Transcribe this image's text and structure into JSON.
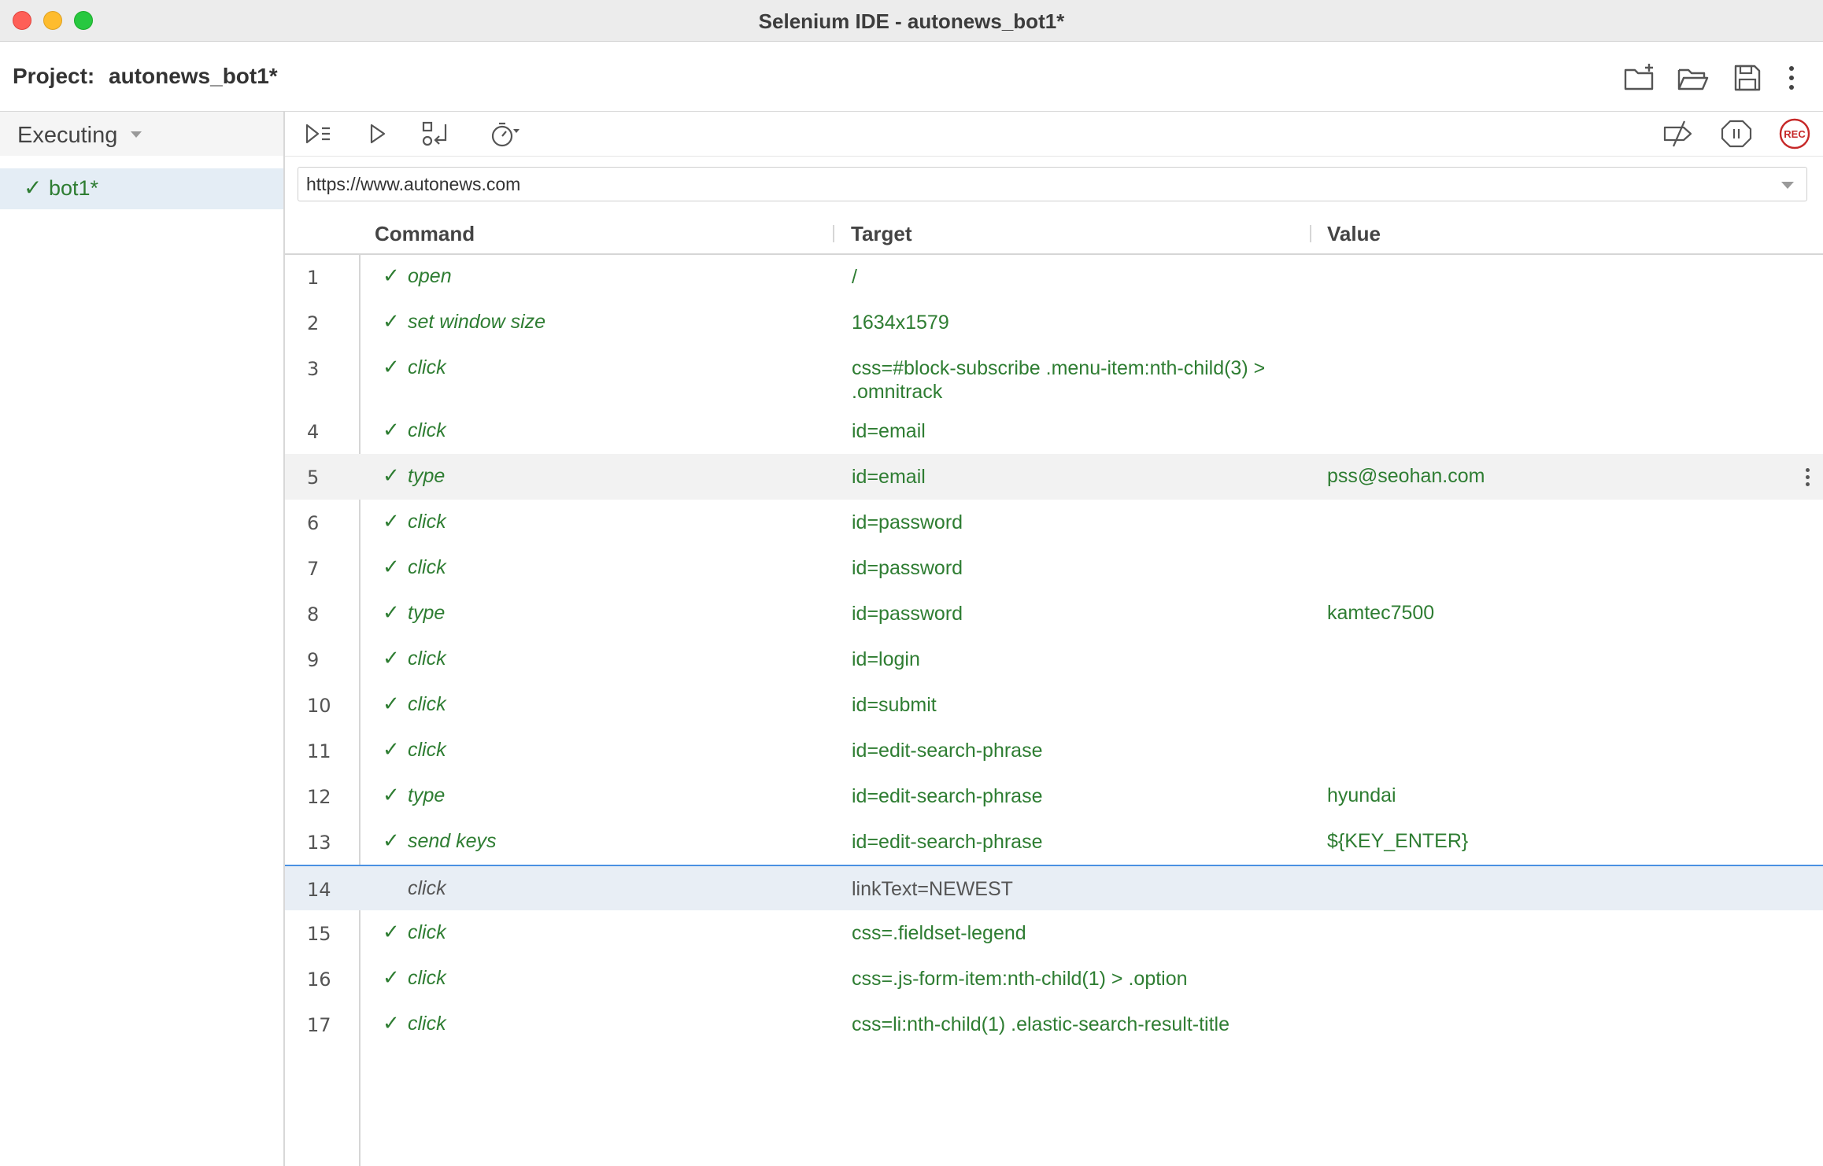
{
  "window": {
    "title": "Selenium IDE - autonews_bot1*"
  },
  "project": {
    "label": "Project:",
    "name": "autonews_bot1*"
  },
  "sidebar": {
    "mode_label": "Executing",
    "tests": [
      {
        "name": "bot1*",
        "status": "passed"
      }
    ]
  },
  "url_bar": {
    "value": "https://www.autonews.com"
  },
  "table": {
    "headers": {
      "command": "Command",
      "target": "Target",
      "value": "Value"
    },
    "rows": [
      {
        "num": "1",
        "command": "open",
        "target": "/",
        "value": "",
        "status": "passed"
      },
      {
        "num": "2",
        "command": "set window size",
        "target": "1634x1579",
        "value": "",
        "status": "passed"
      },
      {
        "num": "3",
        "command": "click",
        "target": "css=#block-subscribe .menu-item:nth-child(3) > .omnitrack",
        "value": "",
        "status": "passed"
      },
      {
        "num": "4",
        "command": "click",
        "target": "id=email",
        "value": "",
        "status": "passed"
      },
      {
        "num": "5",
        "command": "type",
        "target": "id=email",
        "value": "pss@seohan.com",
        "status": "passed"
      },
      {
        "num": "6",
        "command": "click",
        "target": "id=password",
        "value": "",
        "status": "passed"
      },
      {
        "num": "7",
        "command": "click",
        "target": "id=password",
        "value": "",
        "status": "passed"
      },
      {
        "num": "8",
        "command": "type",
        "target": "id=password",
        "value": "kamtec7500",
        "status": "passed"
      },
      {
        "num": "9",
        "command": "click",
        "target": "id=login",
        "value": "",
        "status": "passed"
      },
      {
        "num": "10",
        "command": "click",
        "target": "id=submit",
        "value": "",
        "status": "passed"
      },
      {
        "num": "11",
        "command": "click",
        "target": "id=edit-search-phrase",
        "value": "",
        "status": "passed"
      },
      {
        "num": "12",
        "command": "type",
        "target": "id=edit-search-phrase",
        "value": "hyundai",
        "status": "passed"
      },
      {
        "num": "13",
        "command": "send keys",
        "target": "id=edit-search-phrase",
        "value": "${KEY_ENTER}",
        "status": "passed"
      },
      {
        "num": "14",
        "command": "click",
        "target": "linkText=NEWEST",
        "value": "",
        "status": "pending"
      },
      {
        "num": "15",
        "command": "click",
        "target": "css=.fieldset-legend",
        "value": "",
        "status": "passed"
      },
      {
        "num": "16",
        "command": "click",
        "target": "css=.js-form-item:nth-child(1) > .option",
        "value": "",
        "status": "passed"
      },
      {
        "num": "17",
        "command": "click",
        "target": "css=li:nth-child(1) .elastic-search-result-title",
        "value": "",
        "status": "passed"
      }
    ]
  },
  "toolbar": {
    "icons": [
      "run-all-icon",
      "run-icon",
      "step-over-icon",
      "speed-icon",
      "disable-breakpoints-icon",
      "pause-exceptions-icon",
      "record-icon"
    ],
    "record_label": "REC"
  },
  "header_icons": [
    "new-project-icon",
    "open-project-icon",
    "save-project-icon",
    "more-icon"
  ],
  "colors": {
    "passed": "#2e7d32",
    "current_row_bg": "#e8eef5",
    "current_row_border": "#4a90e2",
    "record": "#c62828"
  },
  "check_glyph": "✓"
}
